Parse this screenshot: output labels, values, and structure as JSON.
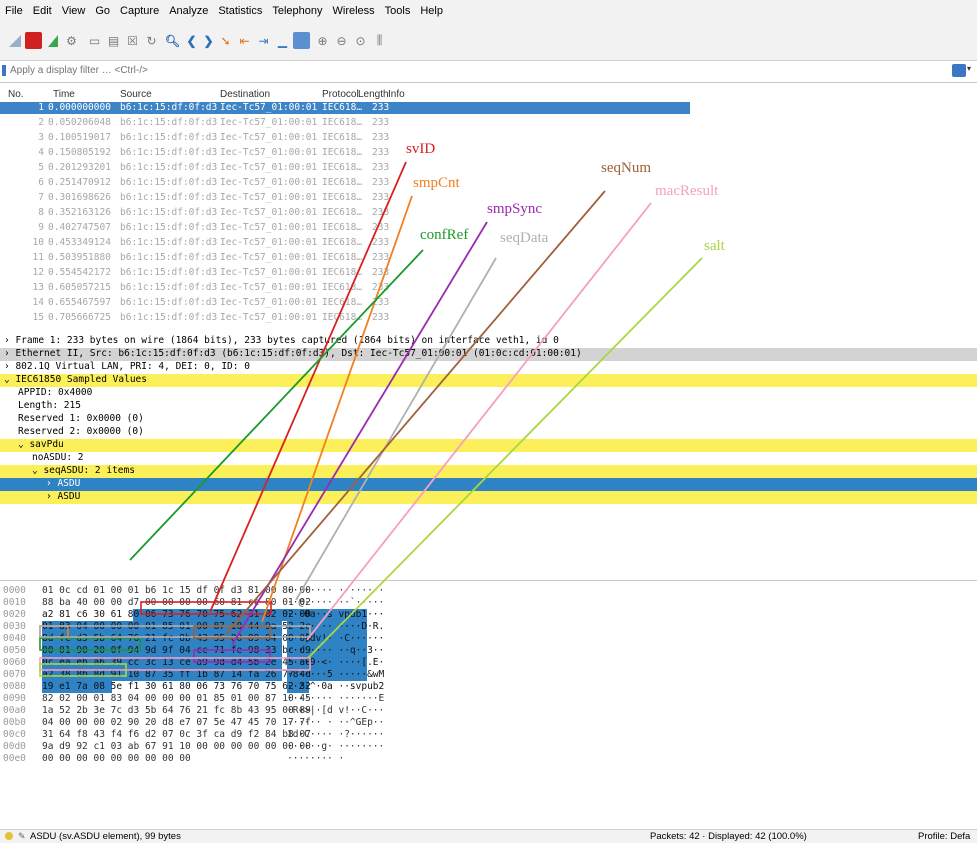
{
  "menu": [
    "File",
    "Edit",
    "View",
    "Go",
    "Capture",
    "Analyze",
    "Statistics",
    "Telephony",
    "Wireless",
    "Tools",
    "Help"
  ],
  "filter": {
    "placeholder": "Apply a display filter … <Ctrl-/>"
  },
  "packet_list": {
    "columns": [
      "No.",
      "Time",
      "Source",
      "Destination",
      "Protocol",
      "Length",
      "Info"
    ],
    "rows": [
      {
        "no": "1",
        "time": "0.000000000",
        "src": "b6:1c:15:df:0f:d3",
        "dst": "Iec-Tc57_01:00:01",
        "proto": "IEC618…",
        "len": "233"
      },
      {
        "no": "2",
        "time": "0.050206048",
        "src": "b6:1c:15:df:0f:d3",
        "dst": "Iec-Tc57_01:00:01",
        "proto": "IEC618…",
        "len": "233"
      },
      {
        "no": "3",
        "time": "0.100519017",
        "src": "b6:1c:15:df:0f:d3",
        "dst": "Iec-Tc57_01:00:01",
        "proto": "IEC618…",
        "len": "233"
      },
      {
        "no": "4",
        "time": "0.150805192",
        "src": "b6:1c:15:df:0f:d3",
        "dst": "Iec-Tc57_01:00:01",
        "proto": "IEC618…",
        "len": "233"
      },
      {
        "no": "5",
        "time": "0.201293201",
        "src": "b6:1c:15:df:0f:d3",
        "dst": "Iec-Tc57_01:00:01",
        "proto": "IEC618…",
        "len": "233"
      },
      {
        "no": "6",
        "time": "0.251470912",
        "src": "b6:1c:15:df:0f:d3",
        "dst": "Iec-Tc57_01:00:01",
        "proto": "IEC618…",
        "len": "233"
      },
      {
        "no": "7",
        "time": "0.301698626",
        "src": "b6:1c:15:df:0f:d3",
        "dst": "Iec-Tc57_01:00:01",
        "proto": "IEC618…",
        "len": "233"
      },
      {
        "no": "8",
        "time": "0.352163126",
        "src": "b6:1c:15:df:0f:d3",
        "dst": "Iec-Tc57_01:00:01",
        "proto": "IEC618…",
        "len": "233"
      },
      {
        "no": "9",
        "time": "0.402747507",
        "src": "b6:1c:15:df:0f:d3",
        "dst": "Iec-Tc57_01:00:01",
        "proto": "IEC618…",
        "len": "233"
      },
      {
        "no": "10",
        "time": "0.453349124",
        "src": "b6:1c:15:df:0f:d3",
        "dst": "Iec-Tc57_01:00:01",
        "proto": "IEC618…",
        "len": "233"
      },
      {
        "no": "11",
        "time": "0.503951880",
        "src": "b6:1c:15:df:0f:d3",
        "dst": "Iec-Tc57_01:00:01",
        "proto": "IEC618…",
        "len": "233"
      },
      {
        "no": "12",
        "time": "0.554542172",
        "src": "b6:1c:15:df:0f:d3",
        "dst": "Iec-Tc57_01:00:01",
        "proto": "IEC618…",
        "len": "233"
      },
      {
        "no": "13",
        "time": "0.605057215",
        "src": "b6:1c:15:df:0f:d3",
        "dst": "Iec-Tc57_01:00:01",
        "proto": "IEC618…",
        "len": "233"
      },
      {
        "no": "14",
        "time": "0.655467597",
        "src": "b6:1c:15:df:0f:d3",
        "dst": "Iec-Tc57_01:00:01",
        "proto": "IEC618…",
        "len": "233"
      },
      {
        "no": "15",
        "time": "0.705666725",
        "src": "b6:1c:15:df:0f:d3",
        "dst": "Iec-Tc57_01:00:01",
        "proto": "IEC618…",
        "len": "233"
      }
    ]
  },
  "details": [
    {
      "text": "› Frame 1: 233 bytes on wire (1864 bits), 233 bytes captured (1864 bits) on interface veth1, id 0",
      "style": "plain"
    },
    {
      "text": "› Ethernet II, Src: b6:1c:15:df:0f:d3 (b6:1c:15:df:0f:d3), Dst: Iec-Tc57_01:00:01 (01:0c:cd:01:00:01)",
      "style": "gray"
    },
    {
      "text": "› 802.1Q Virtual LAN, PRI: 4, DEI: 0, ID: 0",
      "style": "plain"
    },
    {
      "text": "⌄ IEC61850 Sampled Values",
      "style": "yellow"
    },
    {
      "text": "APPID: 0x4000",
      "style": "plain",
      "indent": 1
    },
    {
      "text": "Length: 215",
      "style": "plain",
      "indent": 1
    },
    {
      "text": "Reserved 1: 0x0000 (0)",
      "style": "plain",
      "indent": 1
    },
    {
      "text": "Reserved 2: 0x0000 (0)",
      "style": "plain",
      "indent": 1
    },
    {
      "text": "⌄ savPdu",
      "style": "yellow",
      "indent": 1
    },
    {
      "text": "noASDU: 2",
      "style": "plain",
      "indent": 2
    },
    {
      "text": "⌄ seqASDU: 2 items",
      "style": "yellow",
      "indent": 2
    },
    {
      "text": "› ASDU",
      "style": "blue",
      "indent": 3
    },
    {
      "text": "› ASDU",
      "style": "yellow",
      "indent": 3
    }
  ],
  "hex": [
    {
      "off": "0000",
      "hex": "01 0c cd 01 00 01 b6 1c  15 df 0f d3 81 00 80 00",
      "asc": "········ ········"
    },
    {
      "off": "0010",
      "hex": "88 ba 40 00 00 d7 00 00  00 00 60 81 cc 80 01 02",
      "asc": "··@····· ··`·····"
    },
    {
      "off": "0020",
      "hex": "a2 81 c6 30 61 80 06 73  76 70 75 62 31 82 02 00",
      "asc": "···0a··s vpub1···"
    },
    {
      "off": "0030",
      "hex": "01 83 04 00 00 00 01 85  01 00 87 10 44 9a 52 2e",
      "asc": "········ ····D·R."
    },
    {
      "off": "0040",
      "hex": "8d fc d3 5b 64 76 21 fc  8b 43 95 00 89 04 00 00",
      "asc": "···[dv!· ·C······"
    },
    {
      "off": "0050",
      "hex": "00 01 90 20 0f 94 9d 9f  04 cc 71 fe 98 33 bc d9",
      "asc": "··· ···· ··q··3··"
    },
    {
      "off": "0060",
      "hex": "0c ea eb a6 39 cc 3c 13  ce a9 9d d4 5b 2e 45 a0",
      "asc": "····9·<· ····[.E·"
    },
    {
      "off": "0070",
      "hex": "a2 38 8b 8d 91 10 87 35  ff 1b 87 14 fa 26 77 4d",
      "asc": "·8·····5 ·····&wM"
    },
    {
      "off": "0080",
      "hex": "19 e1 7a 08 5e f1 30 61  80 06 73 76 70 75 62 32",
      "asc": "··z·^·0a ··svpub2"
    },
    {
      "off": "0090",
      "hex": "82 02 00 01 83 04 00 00  00 01 85 01 00 87 10 45",
      "asc": "········ ·······E"
    },
    {
      "off": "00a0",
      "hex": "1a 52 2b 3e 7c d3 5b 64  76 21 fc 8b 43 95 00 89",
      "asc": "·R+>|·[d v!··C···"
    },
    {
      "off": "00b0",
      "hex": "04 00 00 00 02 90 20 d8  e7 07 5e 47 45 70 17 7f",
      "asc": "······ · ··^GEp··"
    },
    {
      "off": "00c0",
      "hex": "31 64 f8 43 f4 f6 d2 07  0c 3f ca d9 f2 84 b8 07",
      "asc": "1d·C···· ·?······"
    },
    {
      "off": "00d0",
      "hex": "9a d9 92 c1 03 ab 67 91  10 00 00 00 00 00 00 00",
      "asc": "······g· ········"
    },
    {
      "off": "00e0",
      "hex": "00 00 00 00 00 00 00 00  00",
      "asc": "········ ·"
    }
  ],
  "annotations": [
    {
      "label": "svID",
      "color": "#d8201f"
    },
    {
      "label": "smpCnt",
      "color": "#f08020"
    },
    {
      "label": "confRef",
      "color": "#1a9a2a"
    },
    {
      "label": "smpSync",
      "color": "#9a2ab0"
    },
    {
      "label": "seqData",
      "color": "#b0b0b0"
    },
    {
      "label": "seqNum",
      "color": "#a0603a"
    },
    {
      "label": "macResult",
      "color": "#f4a0c0"
    },
    {
      "label": "salt",
      "color": "#a8d840"
    }
  ],
  "status": {
    "left": "ASDU (sv.ASDU element), 99 bytes",
    "packets": "Packets: 42 · Displayed: 42 (100.0%)",
    "profile": "Profile: Defa"
  }
}
